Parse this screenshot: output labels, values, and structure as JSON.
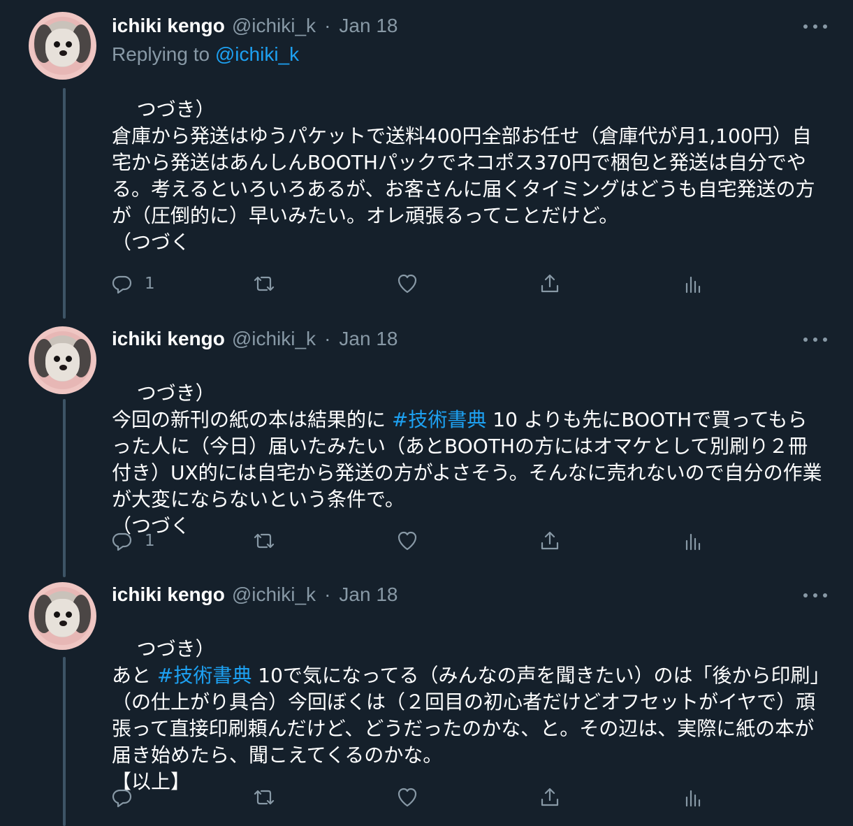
{
  "tweets": [
    {
      "display_name": "ichiki kengo",
      "handle": "@ichiki_k",
      "separator": "·",
      "date": "Jan 18",
      "replying_prefix": "Replying to ",
      "replying_handle": "@ichiki_k",
      "body_parts": [
        {
          "text": "つづき）\n倉庫から発送はゆうパケットで送料400円全部お任せ（倉庫代が月1,100円）自宅から発送はあんしんBOOTHパックでネコポス370円で梱包と発送は自分でやる。考えるといろいろあるが、お客さんに届くタイミングはどうも自宅発送の方が（圧倒的に）早いみたい。オレ頑張るってことだけど。\n（つづく"
        }
      ],
      "reply_count": "1",
      "icons": [
        "reply-icon",
        "retweet-icon",
        "like-icon",
        "share-icon",
        "analytics-icon"
      ]
    },
    {
      "display_name": "ichiki kengo",
      "handle": "@ichiki_k",
      "separator": "·",
      "date": "Jan 18",
      "body_parts": [
        {
          "text": "つづき）\n今回の新刊の紙の本は結果的に "
        },
        {
          "text": "#技術書典",
          "hashtag": true
        },
        {
          "text": " 10 よりも先にBOOTHで買ってもらった人に（今日）届いたみたい（あとBOOTHの方にはオマケとして別刷り２冊付き）UX的には自宅から発送の方がよさそう。そんなに売れないので自分の作業が大変にならないという条件で。\n（つづく"
        }
      ],
      "reply_count": "1",
      "icons": [
        "reply-icon",
        "retweet-icon",
        "like-icon",
        "share-icon",
        "analytics-icon"
      ]
    },
    {
      "display_name": "ichiki kengo",
      "handle": "@ichiki_k",
      "separator": "·",
      "date": "Jan 18",
      "body_parts": [
        {
          "text": "つづき）\nあと "
        },
        {
          "text": "#技術書典",
          "hashtag": true
        },
        {
          "text": " 10で気になってる（みんなの声を聞きたい）のは「後から印刷」（の仕上がり具合）今回ぼくは（２回目の初心者だけどオフセットがイヤで）頑張って直接印刷頼んだけど、どうだったのかな、と。その辺は、実際に紙の本が届き始めたら、聞こえてくるのかな。\n【以上】"
        }
      ],
      "reply_count": "",
      "icons": [
        "reply-icon",
        "retweet-icon",
        "like-icon",
        "share-icon",
        "analytics-icon"
      ]
    }
  ],
  "colors": {
    "background": "#15202b",
    "text": "#ffffff",
    "secondary_text": "#8899a6",
    "link": "#1da1f2",
    "thread_line": "#3d5466"
  }
}
